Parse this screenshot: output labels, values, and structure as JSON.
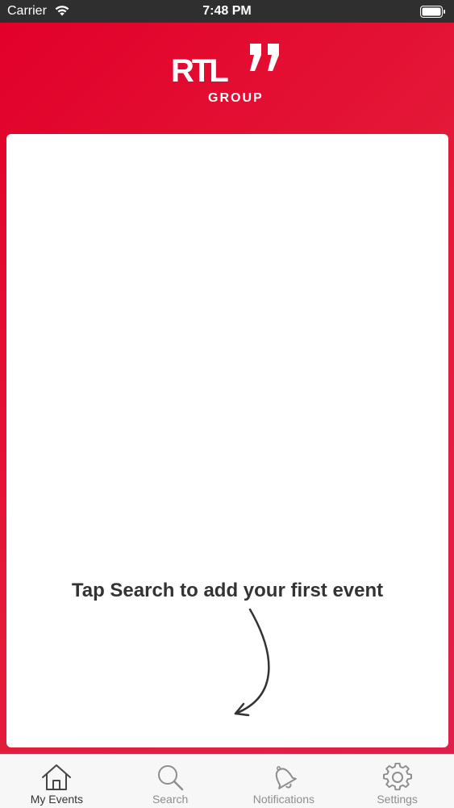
{
  "status_bar": {
    "carrier": "Carrier",
    "time": "7:48 PM"
  },
  "logo": {
    "name": "RTL",
    "sub": "GROUP"
  },
  "main": {
    "empty_message": "Tap Search to add your first event"
  },
  "tab_bar": {
    "tabs": [
      {
        "label": "My Events",
        "icon": "home-icon",
        "active": true
      },
      {
        "label": "Search",
        "icon": "search-icon",
        "active": false
      },
      {
        "label": "Notifications",
        "icon": "bell-icon",
        "active": false
      },
      {
        "label": "Settings",
        "icon": "gear-icon",
        "active": false
      }
    ]
  },
  "colors": {
    "brand_red": "#e2002a",
    "tab_inactive": "#8e8e8e",
    "tab_active": "#333333"
  }
}
